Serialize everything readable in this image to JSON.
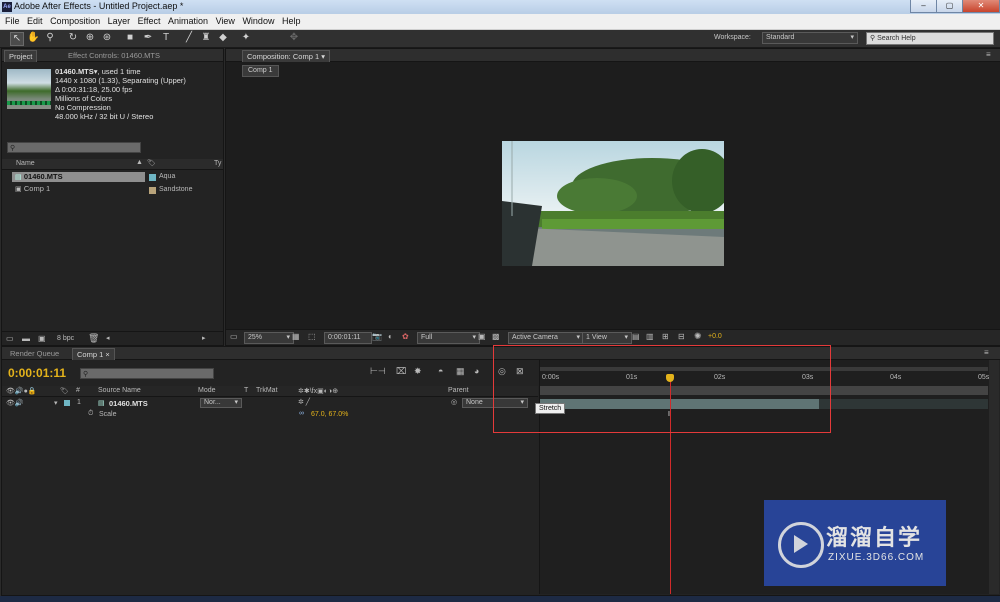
{
  "window": {
    "title": "Adobe After Effects - Untitled Project.aep *",
    "logo_text": "Ae",
    "controls": [
      "–",
      "▢",
      "✕"
    ]
  },
  "menu": [
    "File",
    "Edit",
    "Composition",
    "Layer",
    "Effect",
    "Animation",
    "View",
    "Window",
    "Help"
  ],
  "toolbar": {
    "tools": [
      "selection-tool",
      "hand-tool",
      "zoom-tool",
      "rotation-tool",
      "unified-camera-tool",
      "pan-behind-tool",
      "rectangle-tool",
      "pen-tool",
      "type-tool",
      "brush-tool",
      "clone-stamp-tool",
      "eraser-tool",
      "puppet-pin-tool"
    ],
    "workspace_label": "Workspace:",
    "workspace_value": "Standard",
    "search_placeholder": "Search Help"
  },
  "project_panel": {
    "tabs": [
      "Project",
      "Effect Controls: 01460.MTS"
    ],
    "footage": {
      "name": "01460.MTS",
      "used": ", used 1 time",
      "line1": "1440 x 1080 (1.33), Separating (Upper)",
      "line2": "Δ 0:00:31:18, 25.00 fps",
      "line3": "Millions of Colors",
      "line4": "No Compression",
      "line5": "48.000 kHz / 32 bit U / Stereo"
    },
    "columns": {
      "name": "Name",
      "type": "Ty"
    },
    "items": [
      {
        "name": "01460.MTS",
        "label": "Aqua",
        "label_color": "#6fb6c4"
      },
      {
        "name": "Comp 1",
        "label": "Sandstone",
        "label_color": "#b8a37a"
      }
    ],
    "bpc": "8 bpc"
  },
  "composition_panel": {
    "tab": "Composition: Comp 1",
    "comp_tab": "Comp 1",
    "zoom": "25%",
    "timecode": "0:00:01:11",
    "resolution": "Full",
    "camera": "Active Camera",
    "views": "1 View",
    "exposure": "+0.0"
  },
  "timeline": {
    "tabs": [
      "Render Queue",
      "Comp 1"
    ],
    "current_time": "0:00:01:11",
    "columns": {
      "source": "Source Name",
      "mode": "Mode",
      "t": "T",
      "trkmat": "TrkMat",
      "parent": "Parent"
    },
    "layer": {
      "index": "1",
      "name": "01460.MTS",
      "mode": "Nor...",
      "parent": "None"
    },
    "property": {
      "name": "Scale",
      "value": "67.0, 67.0%"
    },
    "ruler": [
      "0:00s",
      "01s",
      "02s",
      "03s",
      "04s",
      "05s"
    ],
    "tooltip": "Stretch"
  },
  "watermark": {
    "title": "溜溜自学",
    "url": "ZIXUE.3D66.COM"
  }
}
